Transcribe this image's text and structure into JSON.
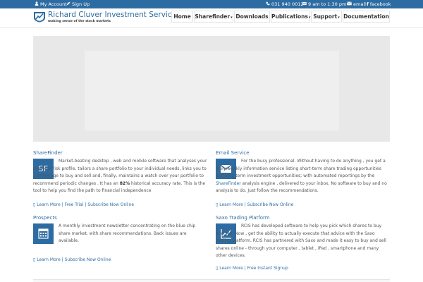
{
  "topbar": {
    "my_account": "My Account",
    "sign_up": "Sign Up",
    "phone": "031 940 0012",
    "hours": "9 am to 1:30 pm",
    "email": "email",
    "facebook": "facebook",
    "bg_color": "#2d6ca2"
  },
  "brand": {
    "title": "Richard Cluver Investment Services",
    "tagline": "making sense of the stock markets"
  },
  "nav": {
    "items": [
      {
        "label": "Home"
      },
      {
        "label": "Sharefinder",
        "caret": "▾"
      },
      {
        "label": "Downloads"
      },
      {
        "label": "Publications",
        "caret": "▾"
      },
      {
        "label": "Support",
        "caret": "▾"
      },
      {
        "label": "Documentation"
      }
    ]
  },
  "sections": {
    "sharefinder": {
      "title": "ShareFinder",
      "tile_text": "SF",
      "text_before": "Market-beating desktop , web and mobile software that analyses your personal risk profile, tailors a share portfolio to your individual needs, links you to a brokerage to buy and sell and, finally, maintains a watch over your portfolio to recommend periodic changes . It has an ",
      "accuracy": "82%",
      "text_after": " historical accuracy rate. This is the tool to help you find the path to financial independence",
      "links": [
        "Learn More",
        "Free Trial",
        "Subscribe Now Online"
      ]
    },
    "email_service": {
      "title": "Email Service",
      "text_before": "For the busy professional. Without having to do anything , you get a daily/weekly information service listing short-term share trading opportunities and long-term investment opportunities; with automated reportings by the ",
      "link_word": "ShareFinder",
      "text_after": " analysis engine , delivered to your inbox. No software to buy and no analysis to do. Just follow the recommendations.",
      "links": [
        "Learn More",
        "Subscribe Now Online"
      ]
    },
    "prospects": {
      "title": "Prospects",
      "text": "A monthly investment newsletter concentrating on the blue chip share market, with share recommendations. Back issues are available.",
      "links": [
        "Learn More",
        "Subscribe Now Online"
      ]
    },
    "saxo": {
      "title": "Saxo Trading Platform",
      "text": "RCIS has developed software to help you pick which shares to buy and sell. Now , get the ability to actually execute that advice with the Saxo trading platform. RCIS has partnered with Saxo and made it easy to buy and sell shares online - through your computer , tablet , iPad , smartphone and many other devices.",
      "links": [
        "Learn More",
        "Free Instant Signup"
      ]
    }
  }
}
